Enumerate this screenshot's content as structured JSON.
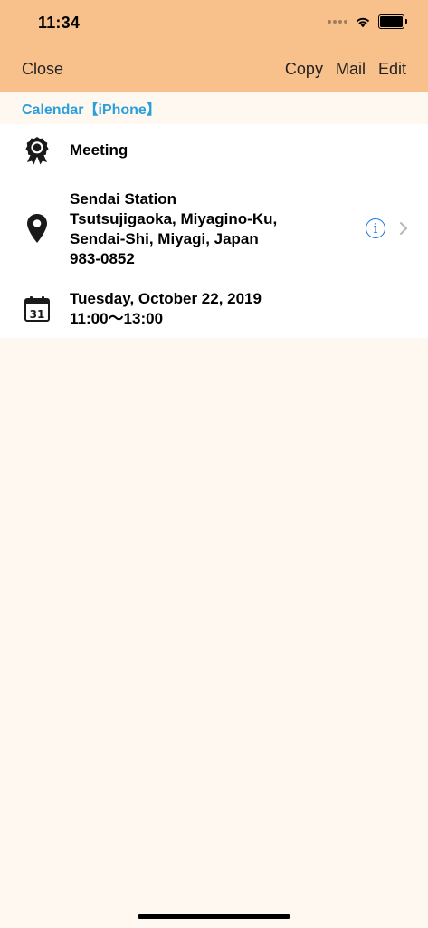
{
  "status_bar": {
    "time": "11:34"
  },
  "nav": {
    "close_label": "Close",
    "copy_label": "Copy",
    "mail_label": "Mail",
    "edit_label": "Edit"
  },
  "section": {
    "label": "Calendar【iPhone】"
  },
  "event": {
    "title": "Meeting",
    "location": {
      "name": "Sendai Station",
      "address_line1": "Tsutsujigaoka, Miyagino-Ku,",
      "address_line2": "Sendai-Shi, Miyagi, Japan",
      "postal_code": "983-0852",
      "info_glyph": "i"
    },
    "date": "Tuesday, October 22, 2019",
    "time_range": "11:00～13:00",
    "calendar_icon_day": "31"
  },
  "colors": {
    "header_bg": "#F8C08A",
    "page_bg": "#FFF8F0",
    "accent_blue": "#2A9FDB",
    "info_blue": "#1A73D8"
  }
}
